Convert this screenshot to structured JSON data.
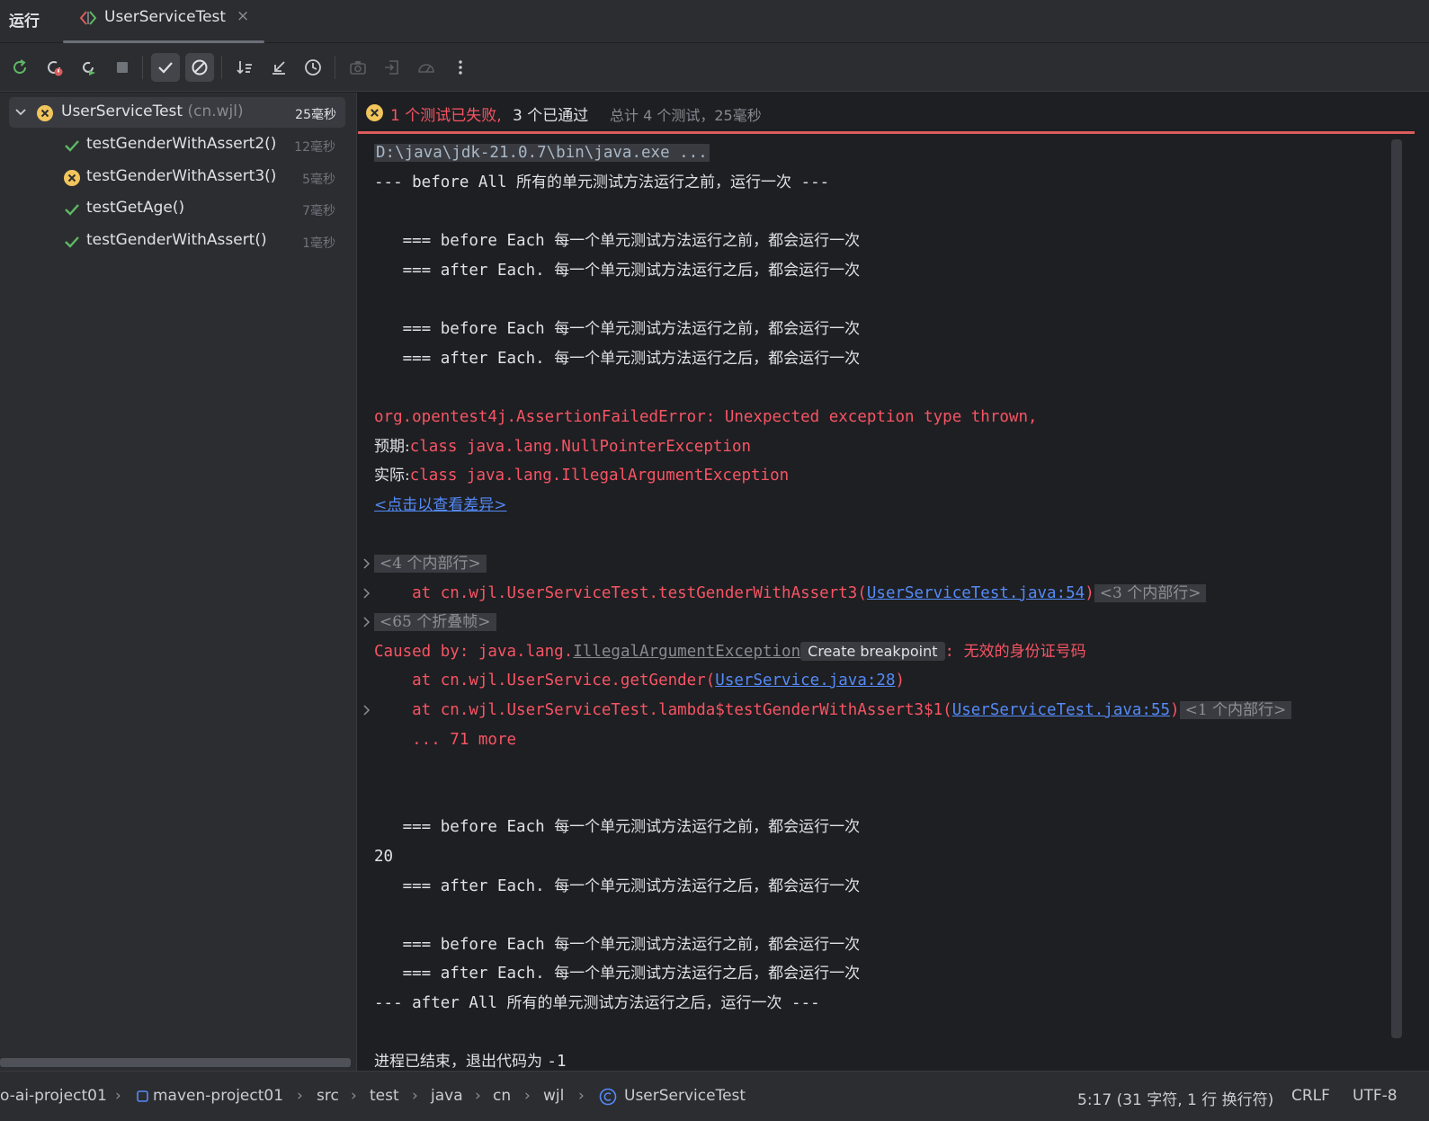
{
  "tabbar": {
    "run_label": "运行",
    "tab_title": "UserServiceTest",
    "tab_close": "×"
  },
  "toolbar": {
    "buttons": [
      "rerun-icon",
      "rerun-failed-icon",
      "rerun-toggle-icon",
      "stop-icon",
      "show-passed-icon",
      "show-ignored-icon",
      "sort-icon",
      "collapse-icon",
      "history-icon",
      "screenshot-icon",
      "import-icon",
      "coverage-icon",
      "more-icon"
    ]
  },
  "tree": {
    "root": {
      "name": "UserServiceTest",
      "package": " (cn.wjl)",
      "duration": "25毫秒",
      "status": "failed"
    },
    "items": [
      {
        "name": "testGenderWithAssert2()",
        "duration": "12毫秒",
        "status": "passed"
      },
      {
        "name": "testGenderWithAssert3()",
        "duration": "5毫秒",
        "status": "failed"
      },
      {
        "name": "testGetAge()",
        "duration": "7毫秒",
        "status": "passed"
      },
      {
        "name": "testGenderWithAssert()",
        "duration": "1毫秒",
        "status": "passed"
      }
    ]
  },
  "summary": {
    "failed_text": "1 个测试已失败,",
    "passed_text": "3 个已通过",
    "total_text": "总计 4 个测试，25毫秒"
  },
  "console": {
    "cmd": "D:\\java\\jdk-21.0.7\\bin\\java.exe ...",
    "before_all_code": "--- before All ",
    "before_all_cjk": "所有的单元测试方法运行之前，运行一次",
    "before_all_tail": " ---",
    "before_each_code": "   === before Each ",
    "before_each_cjk": "每一个单元测试方法运行之前，都会运行一次",
    "after_each_code": "   === after Each. ",
    "after_each_cjk": "每一个单元测试方法运行之后，都会运行一次",
    "err_line1": "org.opentest4j.AssertionFailedError: Unexpected exception type thrown,",
    "expected_label": "预期:",
    "expected_value": "class java.lang.NullPointerException",
    "actual_label": "实际:",
    "actual_value": "class java.lang.IllegalArgumentException",
    "diff_link": "<点击以查看差异>",
    "fold_internal_4": "<4 个内部行>",
    "at_test3_prefix": "    at cn.wjl.UserServiceTest.testGenderWithAssert3(",
    "at_test3_link": "UserServiceTest.java:54",
    "at_test3_suffix": ")",
    "fold_internal_3": "<3 个内部行>",
    "fold_frames_65": "<65 个折叠帧>",
    "caused_prefix": "Caused by: java.lang.",
    "caused_class": "IllegalArgumentException",
    "create_breakpoint": "Create breakpoint",
    "caused_colon": ": ",
    "caused_msg": "无效的身份证号码",
    "at_getgender_prefix": "    at cn.wjl.UserService.getGender(",
    "at_getgender_link": "UserService.java:28",
    "at_getgender_suffix": ")",
    "at_lambda_prefix": "    at cn.wjl.UserServiceTest.lambda$testGenderWithAssert3$1(",
    "at_lambda_link": "UserServiceTest.java:55",
    "at_lambda_suffix": ")",
    "fold_internal_1": "<1 个内部行>",
    "more": "    ... 71 more",
    "output_20": "20",
    "after_all_code": "--- after All ",
    "after_all_cjk": "所有的单元测试方法运行之后，运行一次",
    "after_all_tail": " ---",
    "exit_cjk": "进程已结束，退出代码为 ",
    "exit_code": "-1"
  },
  "statusbar": {
    "crumbs": [
      "o-ai-project01",
      "maven-project01",
      "src",
      "test",
      "java",
      "cn",
      "wjl",
      "UserServiceTest"
    ],
    "sep": "›",
    "position": "5:17 (31 字符, 1 行 换行符)",
    "line_ending": "CRLF",
    "encoding": "UTF-8"
  },
  "colors": {
    "background": "#1e1f22",
    "panel": "#2b2d30",
    "error": "#f75464",
    "passed": "#5fb865",
    "link": "#548af7",
    "warning_icon": "#f2c55c"
  }
}
